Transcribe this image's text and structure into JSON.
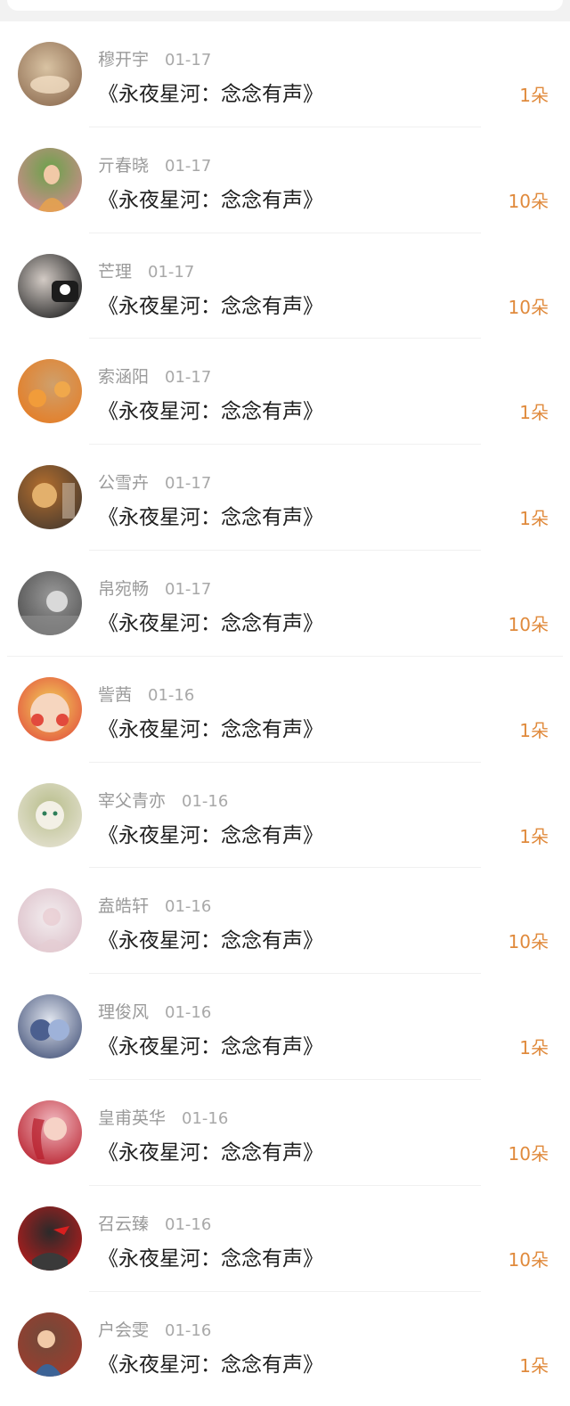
{
  "rows": [
    {
      "name": "穆开宇",
      "date": "01-17",
      "gift": "《永夜星河：念念有声》",
      "count": "1朵",
      "avatar_colors": [
        "#d9c3a3",
        "#8e6d52"
      ]
    },
    {
      "name": "亓春晓",
      "date": "01-17",
      "gift": "《永夜星河：念念有声》",
      "count": "10朵",
      "avatar_colors": [
        "#6aa24a",
        "#d78a93"
      ]
    },
    {
      "name": "芒理",
      "date": "01-17",
      "gift": "《永夜星河：念念有声》",
      "count": "10朵",
      "avatar_colors": [
        "#d3cbc5",
        "#2a2a2a"
      ]
    },
    {
      "name": "索涵阳",
      "date": "01-17",
      "gift": "《永夜星河：念念有声》",
      "count": "1朵",
      "avatar_colors": [
        "#cfa06c",
        "#e77a1f"
      ]
    },
    {
      "name": "公雪卉",
      "date": "01-17",
      "gift": "《永夜星河：念念有声》",
      "count": "1朵",
      "avatar_colors": [
        "#b36e2e",
        "#4a3b2e"
      ]
    },
    {
      "name": "帛宛畅",
      "date": "01-17",
      "gift": "《永夜星河：念念有声》",
      "count": "10朵",
      "avatar_colors": [
        "#9a9a9a",
        "#4b4b4b"
      ]
    },
    {
      "name": "訾茜",
      "date": "01-16",
      "gift": "《永夜星河：念念有声》",
      "count": "1朵",
      "avatar_colors": [
        "#f2d35a",
        "#e24a3d"
      ]
    },
    {
      "name": "宰父青亦",
      "date": "01-16",
      "gift": "《永夜星河：念念有声》",
      "count": "1朵",
      "avatar_colors": [
        "#b7bd8a",
        "#e9e5d8"
      ]
    },
    {
      "name": "盍皓轩",
      "date": "01-16",
      "gift": "《永夜星河：念念有声》",
      "count": "10朵",
      "avatar_colors": [
        "#f3eef0",
        "#d9b9c3"
      ]
    },
    {
      "name": "理俊风",
      "date": "01-16",
      "gift": "《永夜星河：念念有声》",
      "count": "1朵",
      "avatar_colors": [
        "#dfe4ee",
        "#3b4a72"
      ]
    },
    {
      "name": "皇甫英华",
      "date": "01-16",
      "gift": "《永夜星河：念念有声》",
      "count": "10朵",
      "avatar_colors": [
        "#f1b9c0",
        "#b8202d"
      ]
    },
    {
      "name": "召云臻",
      "date": "01-16",
      "gift": "《永夜星河：念念有声》",
      "count": "10朵",
      "avatar_colors": [
        "#2a2a2a",
        "#c61b1b"
      ]
    },
    {
      "name": "户会雯",
      "date": "01-16",
      "gift": "《永夜星河：念念有声》",
      "count": "1朵",
      "avatar_colors": [
        "#6f4a3a",
        "#a43a2c"
      ]
    }
  ]
}
